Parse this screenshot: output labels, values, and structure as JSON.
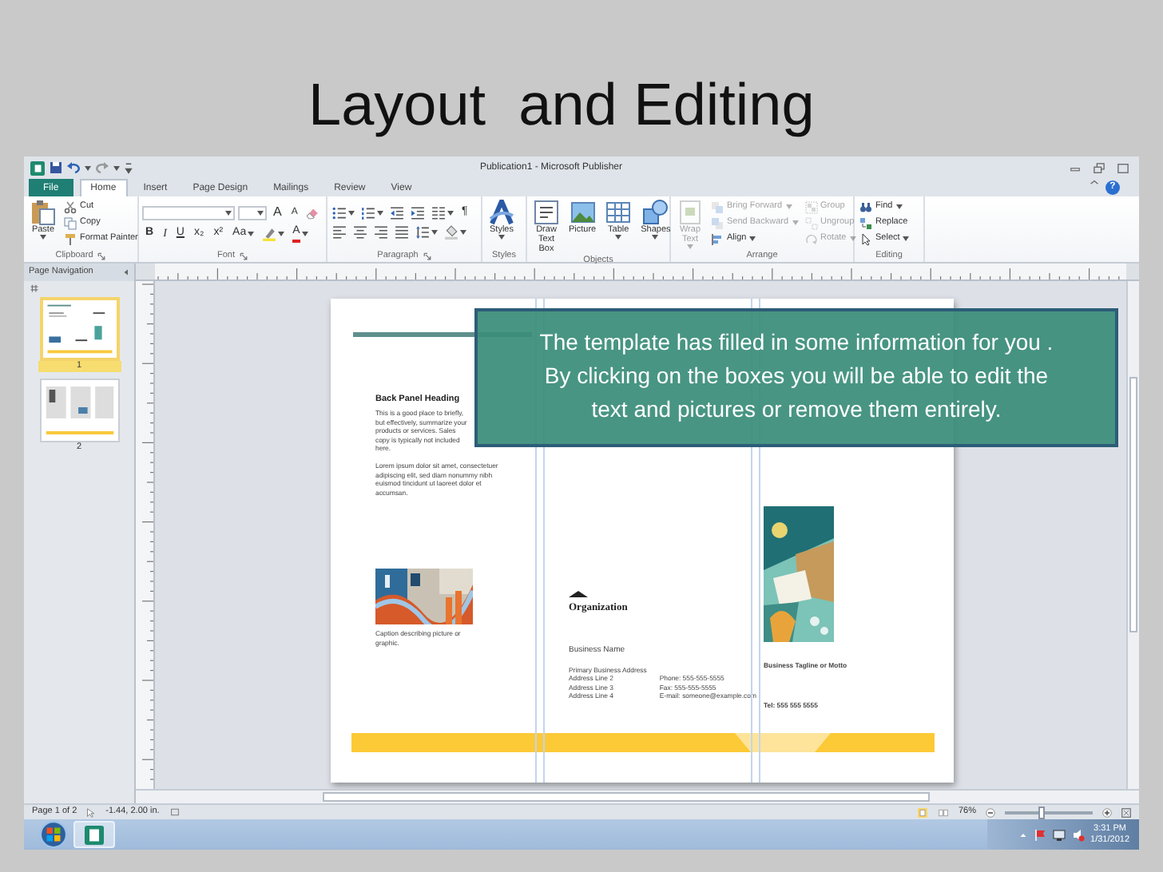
{
  "slide": {
    "title": "Layout  and Editing"
  },
  "window": {
    "title": "Publication1 - Microsoft Publisher",
    "help": "?"
  },
  "tabs": [
    {
      "label": "File",
      "kind": "file",
      "selected": false
    },
    {
      "label": "Home",
      "kind": "tab",
      "selected": true
    },
    {
      "label": "Insert",
      "kind": "tab",
      "selected": false
    },
    {
      "label": "Page Design",
      "kind": "tab",
      "selected": false
    },
    {
      "label": "Mailings",
      "kind": "tab",
      "selected": false
    },
    {
      "label": "Review",
      "kind": "tab",
      "selected": false
    },
    {
      "label": "View",
      "kind": "tab",
      "selected": false
    }
  ],
  "ribbon": {
    "groups": [
      {
        "label": "Clipboard",
        "launcher": true,
        "stacks": [
          [
            {
              "kind": "large",
              "label": "Paste",
              "menu": true,
              "disabled": false
            }
          ],
          [
            {
              "kind": "small",
              "label": "Cut",
              "disabled": false
            },
            {
              "kind": "small",
              "label": "Copy",
              "disabled": false
            },
            {
              "kind": "small",
              "label": "Format Painter",
              "disabled": false
            }
          ]
        ]
      },
      {
        "label": "Font",
        "launcher": true,
        "stacks": [
          [
            {
              "kind": "combo",
              "menu": true,
              "disabled": false
            },
            {
              "kind": "combo",
              "menu": true,
              "disabled": false
            },
            {
              "kind": "glyph",
              "label": "A",
              "disabled": false
            },
            {
              "kind": "glyph",
              "label": "A",
              "disabled": false
            },
            {
              "kind": "icon",
              "disabled": false
            }
          ],
          [
            {
              "kind": "glyph",
              "label": "B",
              "disabled": false
            },
            {
              "kind": "glyph",
              "label": "I",
              "disabled": false
            },
            {
              "kind": "glyph",
              "label": "U",
              "disabled": false
            },
            {
              "kind": "glyph",
              "label": "x₂",
              "disabled": false
            },
            {
              "kind": "glyph",
              "label": "x²",
              "disabled": false
            },
            {
              "kind": "glyph",
              "label": "Aa",
              "menu": true,
              "disabled": false
            },
            {
              "kind": "icon",
              "menu": true,
              "disabled": false
            },
            {
              "kind": "glyph",
              "label": "A",
              "menu": true,
              "disabled": false
            }
          ]
        ]
      },
      {
        "label": "Paragraph",
        "launcher": true,
        "stacks": [
          [
            {
              "kind": "icon",
              "menu": true,
              "disabled": false
            },
            {
              "kind": "icon",
              "menu": true,
              "disabled": false
            },
            {
              "kind": "icon",
              "disabled": false
            },
            {
              "kind": "icon",
              "disabled": false
            },
            {
              "kind": "icon",
              "menu": true,
              "disabled": false
            },
            {
              "kind": "glyph",
              "label": "¶",
              "disabled": false
            }
          ],
          [
            {
              "kind": "icon",
              "disabled": false
            },
            {
              "kind": "icon",
              "disabled": false
            },
            {
              "kind": "icon",
              "disabled": false
            },
            {
              "kind": "icon",
              "disabled": false
            },
            {
              "kind": "icon",
              "menu": true,
              "disabled": false
            },
            {
              "kind": "icon",
              "menu": true,
              "disabled": false
            }
          ]
        ]
      },
      {
        "label": "Styles",
        "launcher": false,
        "stacks": [
          [
            {
              "kind": "large",
              "label": "Styles",
              "menu": true,
              "disabled": false
            }
          ]
        ]
      },
      {
        "label": "Objects",
        "launcher": false,
        "stacks": [
          [
            {
              "kind": "large",
              "label": "Draw Text Box",
              "disabled": false
            }
          ],
          [
            {
              "kind": "large",
              "label": "Picture",
              "disabled": false
            }
          ],
          [
            {
              "kind": "large",
              "label": "Table",
              "menu": true,
              "disabled": false
            }
          ],
          [
            {
              "kind": "large",
              "label": "Shapes",
              "menu": true,
              "disabled": false
            }
          ]
        ]
      },
      {
        "label": "Arrange",
        "launcher": false,
        "stacks": [
          [
            {
              "kind": "large",
              "label": "Wrap Text",
              "menu": true,
              "disabled": true
            }
          ],
          [
            {
              "kind": "small",
              "label": "Bring Forward",
              "menu": true,
              "disabled": true
            },
            {
              "kind": "small",
              "label": "Send Backward",
              "menu": true,
              "disabled": true
            },
            {
              "kind": "small",
              "label": "Align",
              "menu": true,
              "disabled": false
            }
          ],
          [
            {
              "kind": "small",
              "label": "Group",
              "disabled": true
            },
            {
              "kind": "small",
              "label": "Ungroup",
              "disabled": true
            },
            {
              "kind": "small",
              "label": "Rotate",
              "menu": true,
              "disabled": true
            }
          ]
        ]
      },
      {
        "label": "Editing",
        "launcher": false,
        "stacks": [
          [
            {
              "kind": "small",
              "label": "Find",
              "menu": true,
              "disabled": false
            },
            {
              "kind": "small",
              "label": "Replace",
              "disabled": false
            },
            {
              "kind": "small",
              "label": "Select",
              "menu": true,
              "disabled": false
            }
          ]
        ]
      }
    ]
  },
  "navigation": {
    "title": "Page Navigation",
    "pages": [
      {
        "number": "1",
        "selected": true
      },
      {
        "number": "2",
        "selected": false
      }
    ]
  },
  "page": {
    "left_panel": {
      "heading": "Back Panel Heading",
      "body": "This is a good place to briefly, but effectively, summarize your products or services. Sales copy is typically not included here.",
      "body_2": "Lorem ipsum dolor sit amet, consectetuer adipiscing elit, sed diam nonummy nibh euismod tincidunt ut laoreet dolor et accumsan.",
      "caption": "Caption describing picture or graphic."
    },
    "middle_panel": {
      "organization": "Organization",
      "business_name": "Business Name",
      "address": [
        "Primary Business Address",
        "Address Line 2",
        "Address Line 3",
        "Address Line 4"
      ],
      "contact": [
        "Phone: 555-555-5555",
        "Fax: 555-555-5555",
        "E-mail: someone@example.com"
      ]
    },
    "right_panel": {
      "tagline": "Business Tagline or Motto",
      "phone": "Tel: 555 555 5555"
    }
  },
  "callout": {
    "lines": [
      "The template has filled in some information for you .",
      "By clicking on the boxes you will be able to edit the",
      "text and pictures or remove them entirely."
    ]
  },
  "status_bar": {
    "page": "Page 1 of 2",
    "position": "-1.44, 2.00 in.",
    "zoom": "76%",
    "zoom_slider": {
      "level": 0.42
    }
  },
  "taskbar": {
    "time": "3:31 PM",
    "date": "1/31/2012"
  }
}
